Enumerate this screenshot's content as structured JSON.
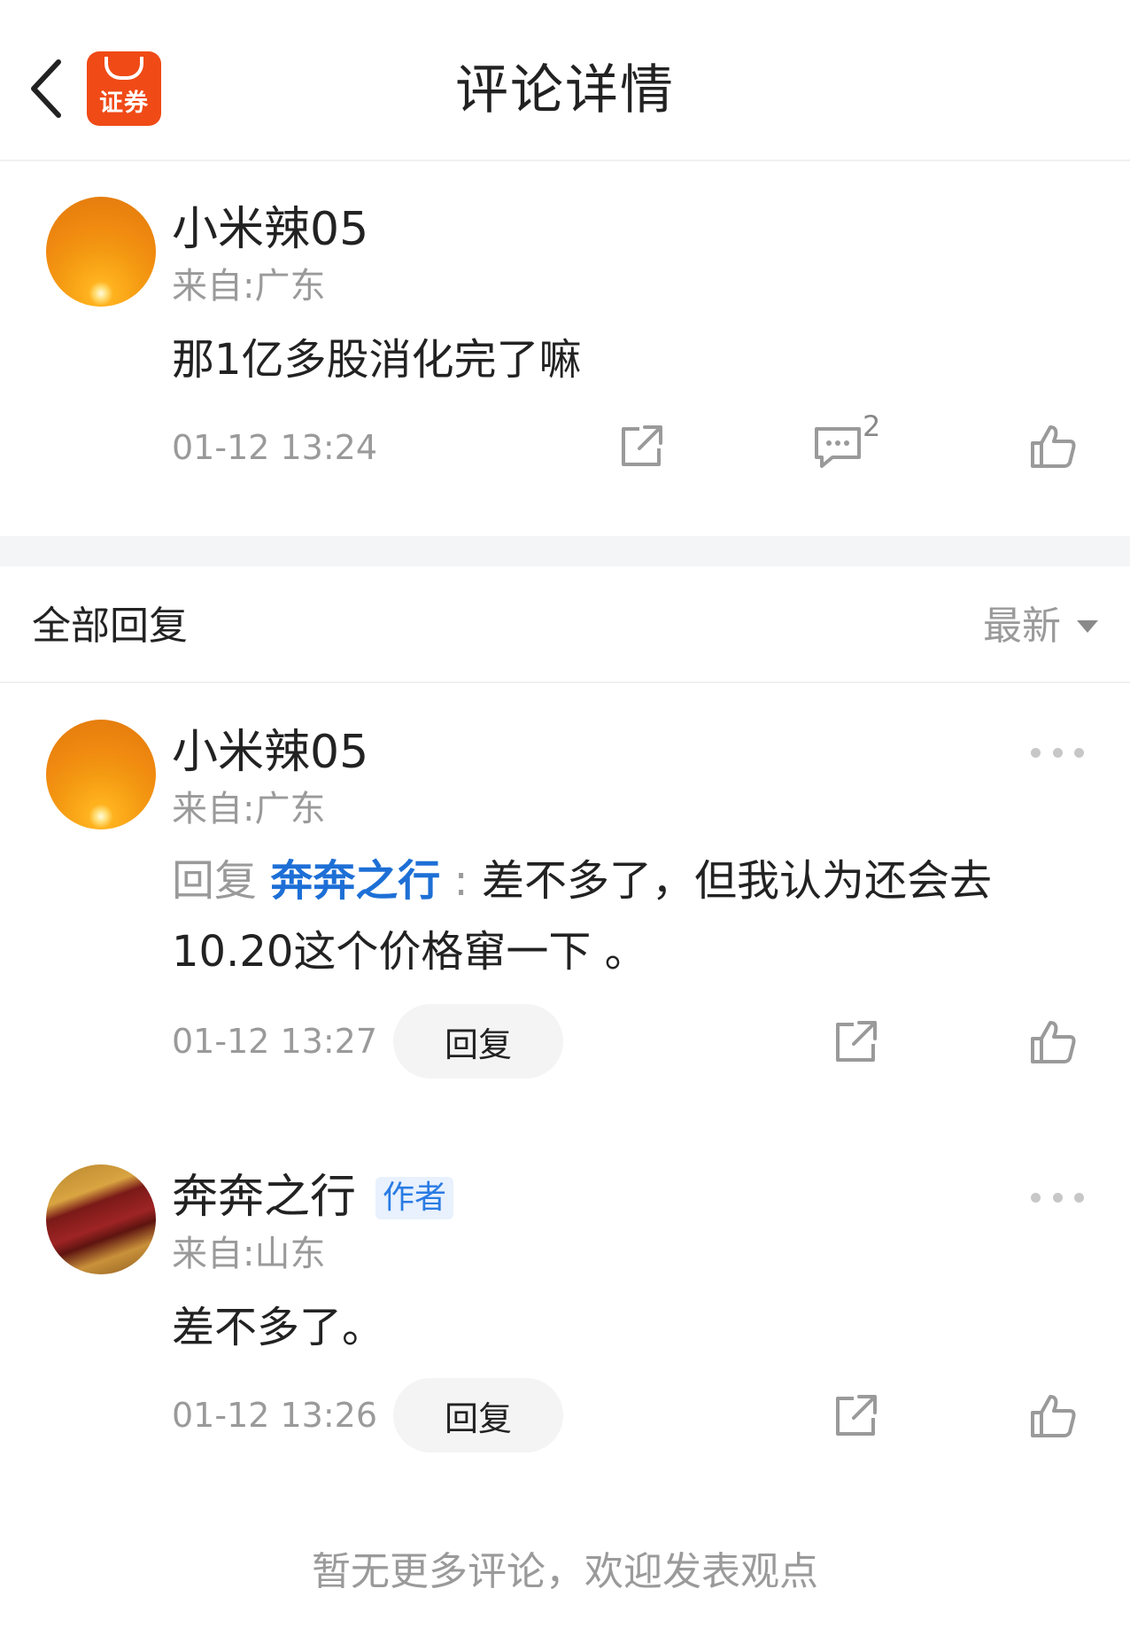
{
  "header": {
    "title": "评论详情",
    "app_logo_text": "证券",
    "brand_color": "#f04a17"
  },
  "main_comment": {
    "username": "小米辣05",
    "location": "来自:广东",
    "content": "那1亿多股消化完了嘛",
    "timestamp": "01-12 13:24",
    "reply_count": "2",
    "avatar": "sunset-avatar"
  },
  "replies_section": {
    "title": "全部回复",
    "sort_label": "最新"
  },
  "replies": [
    {
      "username": "小米辣05",
      "location": "来自:广东",
      "reply_prefix": "回复 ",
      "mention": "奔奔之行",
      "separator": " : ",
      "content_line1": "差不多了，但我认为还会去",
      "content_line2": "10.20这个价格窜一下 。",
      "timestamp": "01-12 13:27",
      "reply_label": "回复",
      "avatar": "sunset-avatar"
    },
    {
      "username": "奔奔之行",
      "badge": "作者",
      "location": "来自:山东",
      "content": "差不多了。",
      "timestamp": "01-12 13:26",
      "reply_label": "回复",
      "avatar": "corn-avatar"
    }
  ],
  "footer": {
    "note": "暂无更多评论，欢迎发表观点"
  },
  "colors": {
    "mention": "#1d6fd6",
    "badge_bg": "#e8f1fd",
    "badge_text": "#2a7be4",
    "muted_text": "#9a9a9a"
  }
}
